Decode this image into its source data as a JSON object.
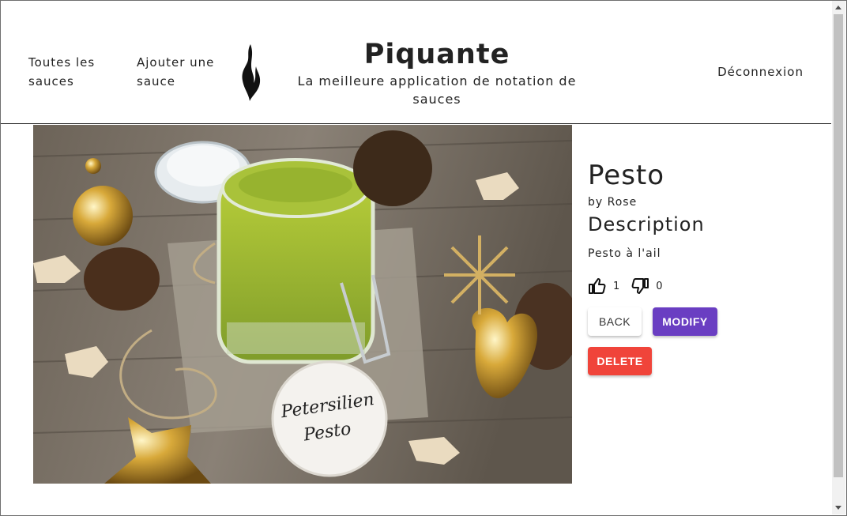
{
  "nav": {
    "all_sauces": "Toutes les sauces",
    "add_sauce": "Ajouter une sauce",
    "logout": "Déconnexion"
  },
  "brand": {
    "title": "Piquante",
    "subtitle": "La meilleure application de notation de sauces"
  },
  "sauce": {
    "name": "Pesto",
    "by": "by Rose",
    "description_heading": "Description",
    "description": "Pesto à l'ail",
    "likes": "1",
    "dislikes": "0",
    "image_label_line1": "Petersilien",
    "image_label_line2": "Pesto"
  },
  "buttons": {
    "back": "BACK",
    "modify": "MODIFY",
    "delete": "DELETE"
  },
  "colors": {
    "modify": "#6a3ec2",
    "delete": "#f0443a"
  }
}
